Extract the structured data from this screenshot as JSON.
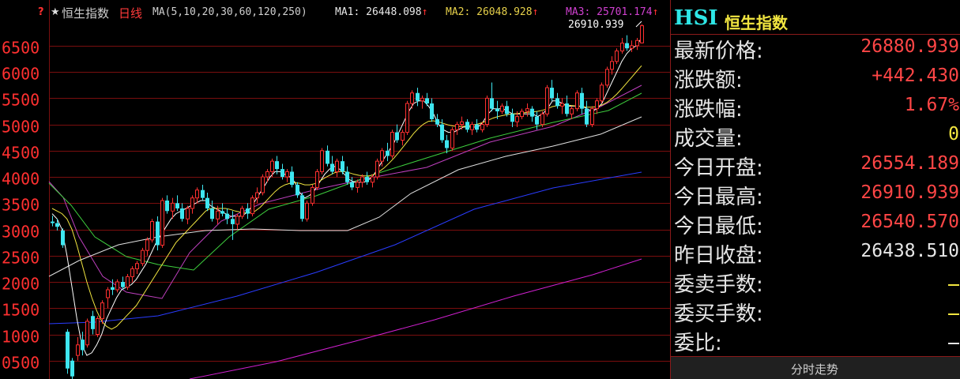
{
  "header": {
    "marker": "?",
    "star": "★",
    "index_name": "恒生指数",
    "period": "日线",
    "ma_params": "MA(5,10,20,30,60,120,250)",
    "ma1": "MA1: 26448.098",
    "ma2": "MA2: 26048.928",
    "ma3": "MA3: 25701.174",
    "arrow": "↑",
    "high_label": "26910.939"
  },
  "panel": {
    "code": "HSI",
    "name": "恒生指数",
    "rows": [
      {
        "label": "最新价格:",
        "value": "26880.939",
        "color": "#ff4646"
      },
      {
        "label": "涨跌额:",
        "value": "+442.430",
        "color": "#ff4646"
      },
      {
        "label": "涨跌幅:",
        "value": "1.67%",
        "color": "#ff4646"
      },
      {
        "label": "成交量:",
        "value": "0",
        "color": "#f2e640"
      },
      {
        "label": "今日开盘:",
        "value": "26554.189",
        "color": "#ff4646"
      },
      {
        "label": "今日最高:",
        "value": "26910.939",
        "color": "#ff4646"
      },
      {
        "label": "今日最低:",
        "value": "26540.570",
        "color": "#ff4646"
      },
      {
        "label": "昨日收盘:",
        "value": "26438.510",
        "color": "#e6e6e6"
      },
      {
        "label": "委卖手数:",
        "value": "",
        "color": "#f2e640"
      },
      {
        "label": "委买手数:",
        "value": "",
        "color": "#f2e640"
      },
      {
        "label": "委比:",
        "value": "",
        "color": "#e6e6e6"
      }
    ],
    "bottom_tab": "分时走势"
  },
  "chart_data": {
    "type": "candlestick",
    "y_ticks": [
      "6500",
      "6000",
      "5500",
      "5000",
      "4500",
      "4000",
      "3500",
      "3000",
      "2500",
      "2000",
      "1500",
      "1000",
      "0500"
    ],
    "y_tick_values": [
      26500,
      26000,
      25500,
      25000,
      24500,
      24000,
      23500,
      23000,
      22500,
      22000,
      21500,
      21000,
      20500
    ],
    "ylim": [
      20150,
      26950
    ],
    "grid": true,
    "colors": {
      "up": "#ff3030",
      "down": "#3ee6f0",
      "grid": "#7a0e0e"
    },
    "candles": [
      {
        "o": 23150,
        "h": 23260,
        "l": 23060,
        "c": 23120
      },
      {
        "o": 23120,
        "h": 23200,
        "l": 22980,
        "c": 23050
      },
      {
        "o": 22980,
        "h": 23020,
        "l": 22650,
        "c": 22700
      },
      {
        "o": 21050,
        "h": 21100,
        "l": 20250,
        "c": 20350
      },
      {
        "o": 20500,
        "h": 20550,
        "l": 20150,
        "c": 20200
      },
      {
        "o": 20600,
        "h": 20950,
        "l": 20500,
        "c": 20800
      },
      {
        "o": 20900,
        "h": 21050,
        "l": 20600,
        "c": 20700
      },
      {
        "o": 20800,
        "h": 21300,
        "l": 20750,
        "c": 21250
      },
      {
        "o": 21350,
        "h": 21450,
        "l": 21000,
        "c": 21100
      },
      {
        "o": 21000,
        "h": 21350,
        "l": 20950,
        "c": 21300
      },
      {
        "o": 21300,
        "h": 21650,
        "l": 21200,
        "c": 21600
      },
      {
        "o": 21700,
        "h": 21900,
        "l": 21500,
        "c": 21850
      },
      {
        "o": 21900,
        "h": 22050,
        "l": 21750,
        "c": 21850
      },
      {
        "o": 21850,
        "h": 22050,
        "l": 21800,
        "c": 22000
      },
      {
        "o": 22000,
        "h": 22100,
        "l": 21850,
        "c": 21900
      },
      {
        "o": 21900,
        "h": 22150,
        "l": 21850,
        "c": 22100
      },
      {
        "o": 22100,
        "h": 22300,
        "l": 22000,
        "c": 22250
      },
      {
        "o": 22250,
        "h": 22400,
        "l": 22150,
        "c": 22350
      },
      {
        "o": 22350,
        "h": 22650,
        "l": 22300,
        "c": 22600
      },
      {
        "o": 22600,
        "h": 22850,
        "l": 22500,
        "c": 22800
      },
      {
        "o": 22800,
        "h": 23200,
        "l": 22750,
        "c": 23150
      },
      {
        "o": 23150,
        "h": 23250,
        "l": 22600,
        "c": 22700
      },
      {
        "o": 22700,
        "h": 23600,
        "l": 22650,
        "c": 23550
      },
      {
        "o": 23550,
        "h": 23650,
        "l": 23300,
        "c": 23350
      },
      {
        "o": 23350,
        "h": 23600,
        "l": 23200,
        "c": 23500
      },
      {
        "o": 23500,
        "h": 23650,
        "l": 23350,
        "c": 23400
      },
      {
        "o": 23400,
        "h": 23500,
        "l": 23150,
        "c": 23200
      },
      {
        "o": 23200,
        "h": 23450,
        "l": 23100,
        "c": 23400
      },
      {
        "o": 23400,
        "h": 23650,
        "l": 23300,
        "c": 23600
      },
      {
        "o": 23600,
        "h": 23800,
        "l": 23500,
        "c": 23750
      },
      {
        "o": 23750,
        "h": 23850,
        "l": 23550,
        "c": 23600
      },
      {
        "o": 23600,
        "h": 23700,
        "l": 23350,
        "c": 23400
      },
      {
        "o": 23400,
        "h": 23550,
        "l": 23150,
        "c": 23200
      },
      {
        "o": 23200,
        "h": 23450,
        "l": 23100,
        "c": 23350
      },
      {
        "o": 23350,
        "h": 23500,
        "l": 23250,
        "c": 23300
      },
      {
        "o": 23300,
        "h": 23400,
        "l": 23100,
        "c": 23200
      },
      {
        "o": 23200,
        "h": 23350,
        "l": 22800,
        "c": 23100
      },
      {
        "o": 23100,
        "h": 23300,
        "l": 23000,
        "c": 23250
      },
      {
        "o": 23250,
        "h": 23450,
        "l": 23200,
        "c": 23400
      },
      {
        "o": 23400,
        "h": 23500,
        "l": 23200,
        "c": 23300
      },
      {
        "o": 23300,
        "h": 23650,
        "l": 23250,
        "c": 23600
      },
      {
        "o": 23600,
        "h": 23800,
        "l": 23500,
        "c": 23700
      },
      {
        "o": 23700,
        "h": 24050,
        "l": 23650,
        "c": 24000
      },
      {
        "o": 24000,
        "h": 24150,
        "l": 23900,
        "c": 24100
      },
      {
        "o": 24100,
        "h": 24350,
        "l": 24000,
        "c": 24300
      },
      {
        "o": 24300,
        "h": 24400,
        "l": 24050,
        "c": 24150
      },
      {
        "o": 24150,
        "h": 24250,
        "l": 23950,
        "c": 24000
      },
      {
        "o": 24000,
        "h": 24150,
        "l": 23900,
        "c": 24100
      },
      {
        "o": 24100,
        "h": 24200,
        "l": 23800,
        "c": 23850
      },
      {
        "o": 23850,
        "h": 23900,
        "l": 23600,
        "c": 23650
      },
      {
        "o": 23650,
        "h": 23700,
        "l": 23150,
        "c": 23200
      },
      {
        "o": 23200,
        "h": 23550,
        "l": 23150,
        "c": 23500
      },
      {
        "o": 23500,
        "h": 23850,
        "l": 23450,
        "c": 23800
      },
      {
        "o": 23800,
        "h": 24150,
        "l": 23750,
        "c": 24100
      },
      {
        "o": 24100,
        "h": 24550,
        "l": 24050,
        "c": 24500
      },
      {
        "o": 24500,
        "h": 24600,
        "l": 24200,
        "c": 24250
      },
      {
        "o": 24250,
        "h": 24400,
        "l": 24050,
        "c": 24100
      },
      {
        "o": 24100,
        "h": 24350,
        "l": 24000,
        "c": 24300
      },
      {
        "o": 24300,
        "h": 24400,
        "l": 24050,
        "c": 24100
      },
      {
        "o": 24100,
        "h": 24200,
        "l": 23850,
        "c": 23900
      },
      {
        "o": 23900,
        "h": 24000,
        "l": 23750,
        "c": 23800
      },
      {
        "o": 23800,
        "h": 23950,
        "l": 23700,
        "c": 23900
      },
      {
        "o": 23900,
        "h": 24050,
        "l": 23800,
        "c": 24000
      },
      {
        "o": 24000,
        "h": 24100,
        "l": 23850,
        "c": 23900
      },
      {
        "o": 23900,
        "h": 24050,
        "l": 23800,
        "c": 24000
      },
      {
        "o": 24000,
        "h": 24350,
        "l": 23950,
        "c": 24300
      },
      {
        "o": 24300,
        "h": 24550,
        "l": 24200,
        "c": 24500
      },
      {
        "o": 24500,
        "h": 24650,
        "l": 24300,
        "c": 24400
      },
      {
        "o": 24400,
        "h": 24900,
        "l": 24350,
        "c": 24850
      },
      {
        "o": 24850,
        "h": 25000,
        "l": 24650,
        "c": 24700
      },
      {
        "o": 24700,
        "h": 24900,
        "l": 24600,
        "c": 24850
      },
      {
        "o": 24850,
        "h": 25450,
        "l": 24800,
        "c": 25400
      },
      {
        "o": 25400,
        "h": 25650,
        "l": 25300,
        "c": 25600
      },
      {
        "o": 25600,
        "h": 25700,
        "l": 25350,
        "c": 25450
      },
      {
        "o": 25450,
        "h": 25550,
        "l": 25300,
        "c": 25500
      },
      {
        "o": 25500,
        "h": 25600,
        "l": 25350,
        "c": 25400
      },
      {
        "o": 25400,
        "h": 25500,
        "l": 25050,
        "c": 25100
      },
      {
        "o": 25100,
        "h": 25200,
        "l": 24950,
        "c": 25000
      },
      {
        "o": 25000,
        "h": 25100,
        "l": 24650,
        "c": 24700
      },
      {
        "o": 24700,
        "h": 24800,
        "l": 24450,
        "c": 24550
      },
      {
        "o": 24550,
        "h": 24950,
        "l": 24500,
        "c": 24900
      },
      {
        "o": 24900,
        "h": 25050,
        "l": 24800,
        "c": 25000
      },
      {
        "o": 25000,
        "h": 25150,
        "l": 24900,
        "c": 25050
      },
      {
        "o": 25050,
        "h": 25100,
        "l": 24850,
        "c": 24900
      },
      {
        "o": 24900,
        "h": 25050,
        "l": 24800,
        "c": 25000
      },
      {
        "o": 25000,
        "h": 25100,
        "l": 24850,
        "c": 24900
      },
      {
        "o": 24900,
        "h": 25050,
        "l": 24850,
        "c": 25000
      },
      {
        "o": 25000,
        "h": 25550,
        "l": 24950,
        "c": 25500
      },
      {
        "o": 25500,
        "h": 25800,
        "l": 25250,
        "c": 25300
      },
      {
        "o": 25300,
        "h": 25450,
        "l": 25100,
        "c": 25250
      },
      {
        "o": 25250,
        "h": 25400,
        "l": 25200,
        "c": 25350
      },
      {
        "o": 25350,
        "h": 25450,
        "l": 25150,
        "c": 25200
      },
      {
        "o": 25200,
        "h": 25300,
        "l": 24950,
        "c": 25050
      },
      {
        "o": 25050,
        "h": 25250,
        "l": 24950,
        "c": 25150
      },
      {
        "o": 25150,
        "h": 25300,
        "l": 25100,
        "c": 25250
      },
      {
        "o": 25250,
        "h": 25400,
        "l": 25150,
        "c": 25300
      },
      {
        "o": 25300,
        "h": 25350,
        "l": 25050,
        "c": 25150
      },
      {
        "o": 25150,
        "h": 25250,
        "l": 24900,
        "c": 25000
      },
      {
        "o": 25000,
        "h": 25250,
        "l": 24950,
        "c": 25200
      },
      {
        "o": 25200,
        "h": 25750,
        "l": 25150,
        "c": 25700
      },
      {
        "o": 25700,
        "h": 25850,
        "l": 25450,
        "c": 25500
      },
      {
        "o": 25500,
        "h": 25600,
        "l": 25300,
        "c": 25350
      },
      {
        "o": 25350,
        "h": 25500,
        "l": 25200,
        "c": 25400
      },
      {
        "o": 25400,
        "h": 25550,
        "l": 25150,
        "c": 25200
      },
      {
        "o": 25200,
        "h": 25350,
        "l": 25100,
        "c": 25300
      },
      {
        "o": 25300,
        "h": 25650,
        "l": 25250,
        "c": 25600
      },
      {
        "o": 25600,
        "h": 25700,
        "l": 25200,
        "c": 25300
      },
      {
        "o": 25300,
        "h": 25450,
        "l": 24950,
        "c": 25000
      },
      {
        "o": 25000,
        "h": 25350,
        "l": 24950,
        "c": 25300
      },
      {
        "o": 25300,
        "h": 25500,
        "l": 25200,
        "c": 25450
      },
      {
        "o": 25450,
        "h": 25800,
        "l": 25400,
        "c": 25750
      },
      {
        "o": 25750,
        "h": 26100,
        "l": 25700,
        "c": 26050
      },
      {
        "o": 26050,
        "h": 26300,
        "l": 25950,
        "c": 26200
      },
      {
        "o": 26200,
        "h": 26450,
        "l": 26150,
        "c": 26400
      },
      {
        "o": 26400,
        "h": 26650,
        "l": 26350,
        "c": 26550
      },
      {
        "o": 26550,
        "h": 26700,
        "l": 26400,
        "c": 26450
      },
      {
        "o": 26450,
        "h": 26600,
        "l": 26380,
        "c": 26500
      },
      {
        "o": 26500,
        "h": 26650,
        "l": 26420,
        "c": 26600
      },
      {
        "o": 26554,
        "h": 26911,
        "l": 26541,
        "c": 26881
      }
    ],
    "ma_lines": [
      {
        "color": "#ffffff",
        "values": [
          23300,
          23200,
          23000,
          22500,
          21900,
          21300,
          20800,
          20600,
          20650,
          20800,
          21000,
          21300,
          21500,
          21700,
          21850,
          21900,
          21950,
          22050,
          22200,
          22350,
          22550,
          22750,
          22900,
          23050,
          23200,
          23300,
          23350,
          23400,
          23450,
          23500,
          23550,
          23550,
          23450,
          23400,
          23350,
          23300,
          23250,
          23250,
          23250,
          23300,
          23400,
          23550,
          23700,
          23850,
          24000,
          24100,
          24100,
          24050,
          24000,
          23900,
          23700,
          23600,
          23650,
          23750,
          23900,
          24050,
          24150,
          24200,
          24150,
          24050,
          23950,
          23900,
          23900,
          23900,
          23950,
          24050,
          24200,
          24350,
          24500,
          24650,
          24850,
          25050,
          25250,
          25400,
          25450,
          25450,
          25350,
          25200,
          25000,
          24900,
          24850,
          24850,
          24900,
          24950,
          24950,
          24950,
          24950,
          25050,
          25200,
          25300,
          25300,
          25300,
          25250,
          25200,
          25200,
          25200,
          25200,
          25200,
          25150,
          25200,
          25300,
          25450,
          25450,
          25400,
          25350,
          25350,
          25350,
          25350,
          25300,
          25250,
          25300,
          25400,
          25600,
          25800,
          26000,
          26200,
          26350,
          26450,
          26500,
          26650
        ]
      },
      {
        "color": "#f2e640",
        "values": [
          23400,
          23350,
          23300,
          23200,
          23000,
          22700,
          22350,
          22000,
          21700,
          21450,
          21250,
          21150,
          21100,
          21150,
          21250,
          21350,
          21450,
          21550,
          21700,
          21850,
          22000,
          22150,
          22300,
          22450,
          22600,
          22750,
          22850,
          22950,
          23050,
          23150,
          23250,
          23350,
          23400,
          23400,
          23400,
          23400,
          23380,
          23350,
          23330,
          23320,
          23320,
          23350,
          23420,
          23520,
          23620,
          23720,
          23800,
          23850,
          23880,
          23890,
          23880,
          23850,
          23850,
          23870,
          23920,
          23980,
          24030,
          24080,
          24100,
          24100,
          24080,
          24050,
          24030,
          24020,
          24020,
          24050,
          24100,
          24170,
          24260,
          24360,
          24470,
          24590,
          24710,
          24830,
          24930,
          25010,
          25060,
          25070,
          25050,
          25020,
          24990,
          24970,
          24960,
          24960,
          24970,
          24990,
          25010,
          25040,
          25080,
          25120,
          25150,
          25170,
          25190,
          25200,
          25210,
          25220,
          25230,
          25240,
          25250,
          25270,
          25300,
          25340,
          25360,
          25370,
          25370,
          25360,
          25350,
          25340,
          25330,
          25330,
          25340,
          25370,
          25420,
          25490,
          25580,
          25680,
          25790,
          25900,
          26010,
          26120
        ]
      }
    ]
  }
}
